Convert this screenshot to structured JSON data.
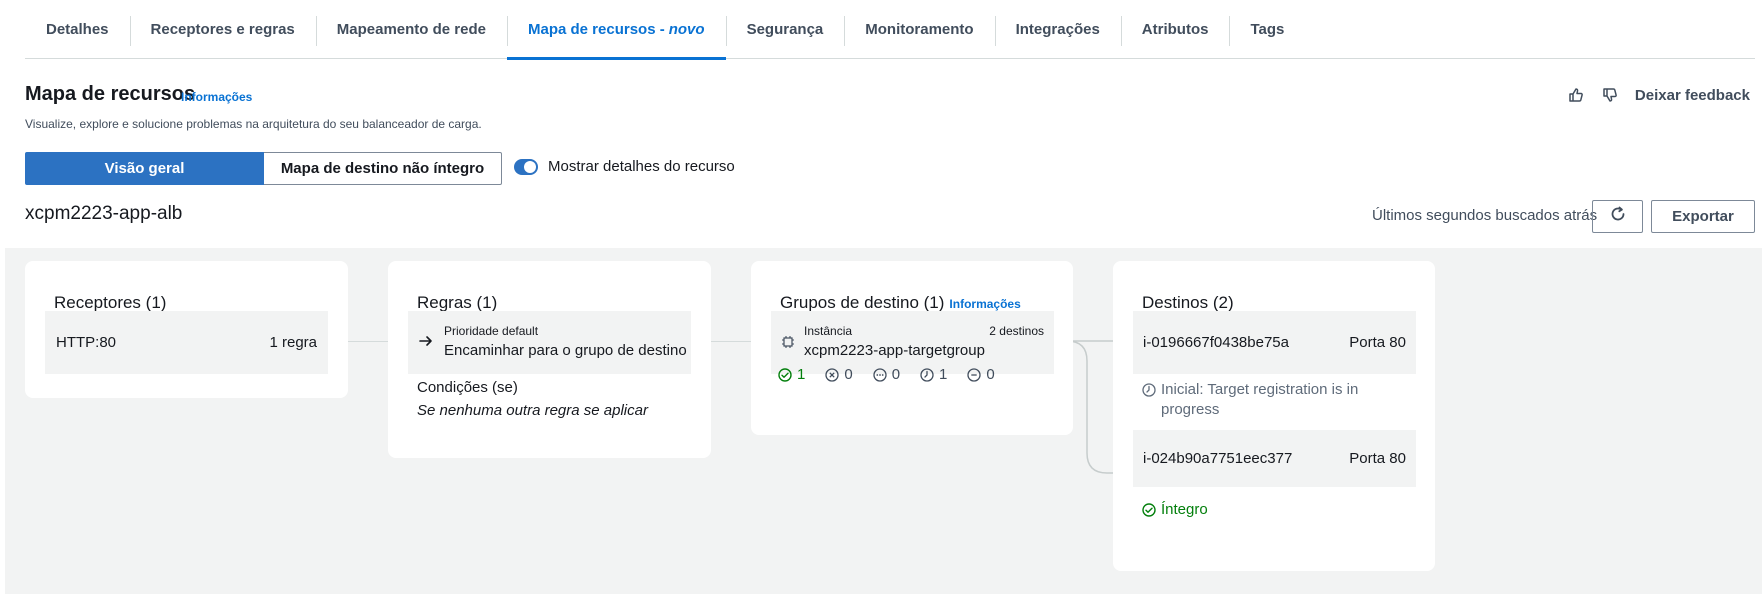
{
  "tabs": [
    {
      "label": "Detalhes"
    },
    {
      "label": "Receptores e regras"
    },
    {
      "label": "Mapeamento de rede"
    },
    {
      "label": "Mapa de recursos -",
      "badge": "novo"
    },
    {
      "label": "Segurança"
    },
    {
      "label": "Monitoramento"
    },
    {
      "label": "Integrações"
    },
    {
      "label": "Atributos"
    },
    {
      "label": "Tags"
    }
  ],
  "header": {
    "title": "Mapa de recursos",
    "info": "Informações",
    "description": "Visualize, explore e solucione problemas na arquitetura do seu balanceador de carga.",
    "feedback": "Deixar feedback"
  },
  "view": {
    "overview": "Visão geral",
    "unhealthy_map": "Mapa de destino não íntegro",
    "toggle_label": "Mostrar detalhes do recurso"
  },
  "resource": {
    "name": "xcpm2223-app-alb",
    "last_fetched": "Últimos segundos buscados atrás",
    "export": "Exportar"
  },
  "listeners": {
    "title": "Receptores (1)",
    "item": {
      "name": "HTTP:80",
      "rules": "1 regra"
    }
  },
  "rules": {
    "title": "Regras (1)",
    "item": {
      "priority": "Prioridade default",
      "action": "Encaminhar para o grupo de destino"
    },
    "conditions_label": "Condições (se)",
    "conditions_value": "Se nenhuma outra regra se aplicar"
  },
  "target_groups": {
    "title": "Grupos de destino (1)",
    "info": "Informações",
    "item": {
      "type": "Instância",
      "count": "2 destinos",
      "name": "xcpm2223-app-targetgroup"
    },
    "stats": {
      "healthy": "1",
      "unhealthy": "0",
      "unused": "0",
      "initial": "1",
      "draining": "0"
    }
  },
  "targets": {
    "title": "Destinos (2)",
    "items": [
      {
        "id": "i-0196667f0438be75a",
        "port": "Porta 80",
        "status": "Inicial: Target registration is in progress"
      },
      {
        "id": "i-024b90a7751eec377",
        "port": "Porta 80",
        "status": "Íntegro"
      }
    ]
  },
  "colors": {
    "accent": "#0972d3",
    "healthy": "#037f0c",
    "canvas": "#f2f3f3"
  }
}
